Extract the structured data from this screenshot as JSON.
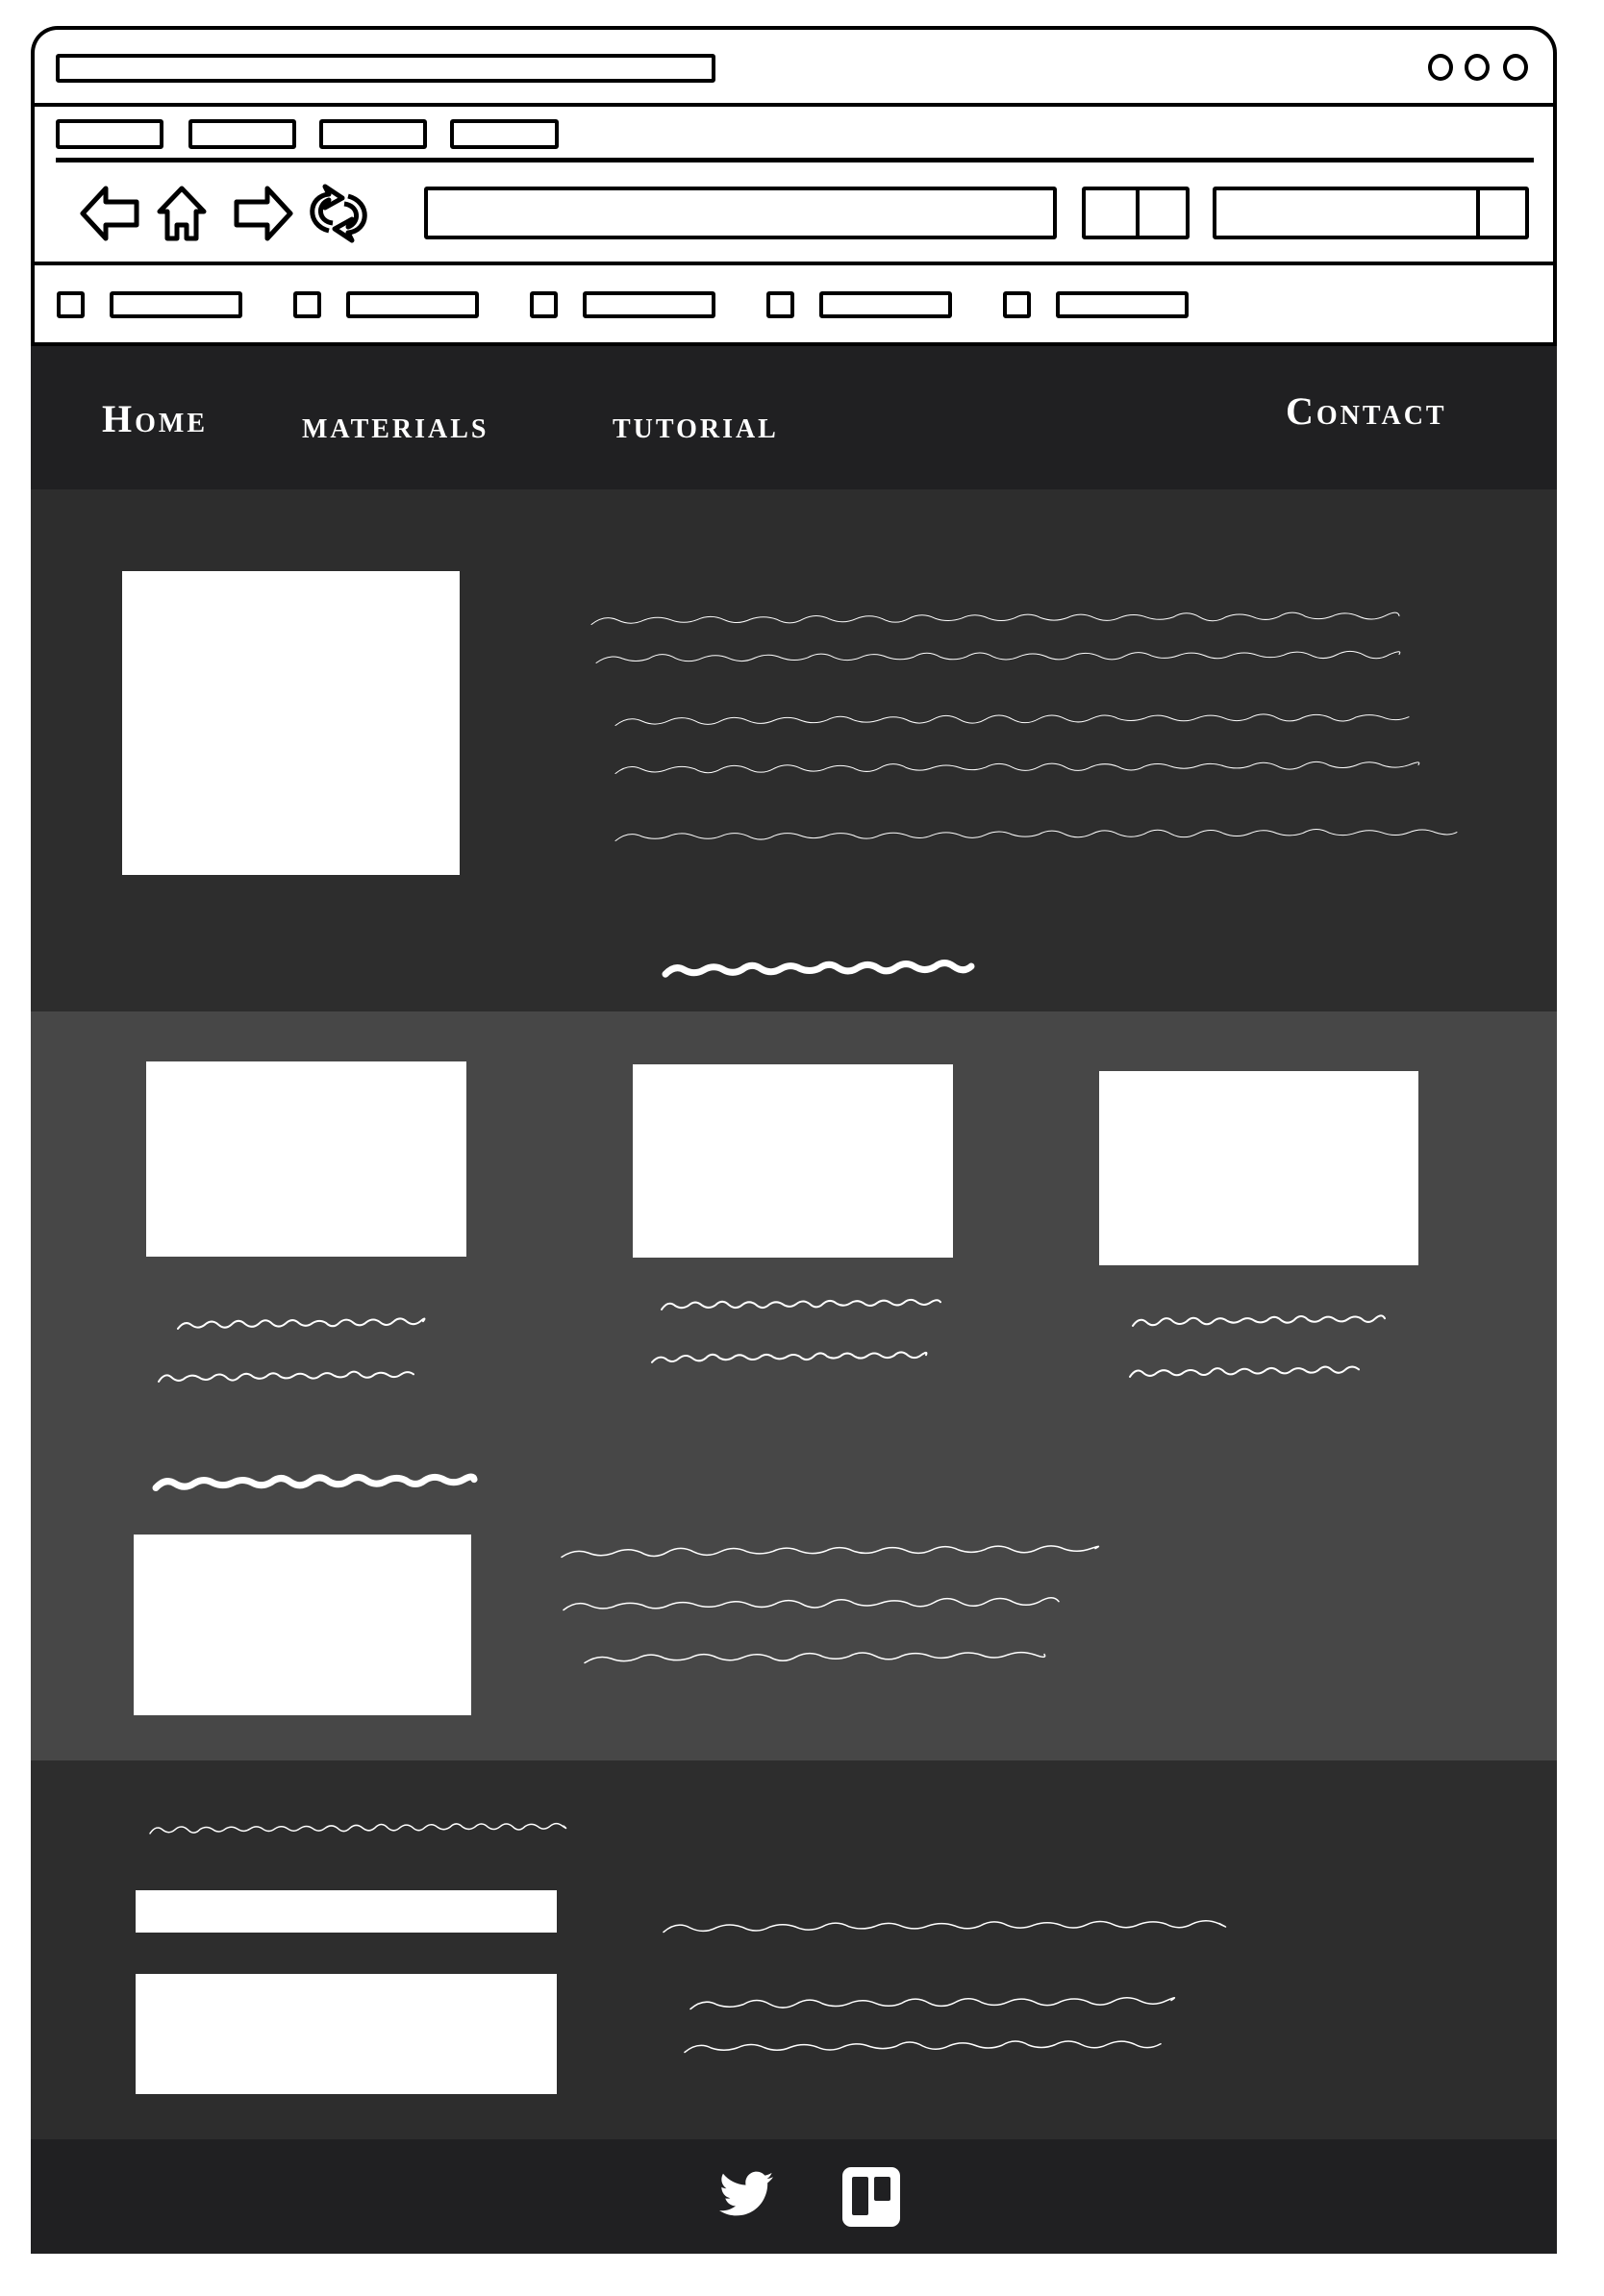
{
  "browser": {
    "icons": [
      "back-arrow-icon",
      "home-icon",
      "forward-arrow-icon",
      "refresh-icon"
    ],
    "window_controls": [
      "window-control-1",
      "window-control-2",
      "window-control-3"
    ]
  },
  "nav": {
    "items": [
      {
        "label": "Home"
      },
      {
        "label": "materials"
      },
      {
        "label": "tutorial"
      },
      {
        "label": "Contact"
      }
    ]
  },
  "footer": {
    "icons": [
      "twitter-icon",
      "trello-icon"
    ]
  },
  "colors": {
    "nav_bg": "#202022",
    "hero_bg": "#2d2d2d",
    "middle_bg": "#474747",
    "contact_bg": "#2d2d2d",
    "footer_bg": "#202022"
  }
}
